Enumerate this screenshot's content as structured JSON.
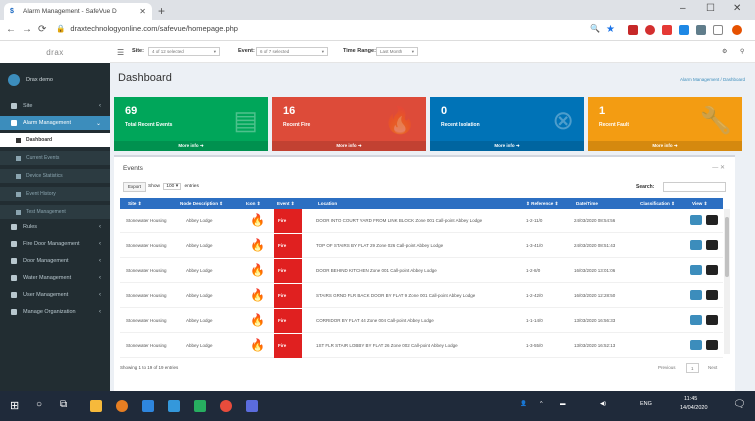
{
  "browser": {
    "tab_title": "Alarm Management - SafeVue D",
    "url": "draxtechnologyonline.com/safevue/homepage.php"
  },
  "logo": "drax",
  "user": {
    "name": "Drax demo"
  },
  "sidebar": {
    "items": [
      {
        "label": "Site"
      },
      {
        "label": "Alarm Management"
      },
      {
        "label": "Rules"
      },
      {
        "label": "Fire Door Management"
      },
      {
        "label": "Door Management"
      },
      {
        "label": "Water Management"
      },
      {
        "label": "User Management"
      },
      {
        "label": "Manage Organization"
      }
    ],
    "subitems": [
      {
        "label": "Dashboard"
      },
      {
        "label": "Current Events"
      },
      {
        "label": "Device Statistics"
      },
      {
        "label": "Event History"
      },
      {
        "label": "Test Management"
      }
    ]
  },
  "topbar": {
    "site_label": "Site:",
    "site_value": "4 of 12 selected",
    "event_label": "Event:",
    "event_value": "6 of 7 selected",
    "time_label": "Time Range:",
    "time_value": "Last Month"
  },
  "page": {
    "title": "Dashboard",
    "breadcrumb": "Alarm Management / Dashboard"
  },
  "boxes": [
    {
      "number": "69",
      "label": "Total Recent Events",
      "more": "More info",
      "color": "#00a65a"
    },
    {
      "number": "16",
      "label": "Recent Fire",
      "more": "More info",
      "color": "#dd4b39"
    },
    {
      "number": "0",
      "label": "Recent Isolation",
      "more": "More info",
      "color": "#0073b7"
    },
    {
      "number": "1",
      "label": "Recent Fault",
      "more": "More info",
      "color": "#f39c12"
    }
  ],
  "events": {
    "title": "Events",
    "export_label": "Export",
    "show_label": "Show",
    "show_value": "100",
    "entries_label": "entries",
    "search_label": "Search:",
    "columns": {
      "site": "Site",
      "node": "Node Description",
      "icon": "Icon",
      "event": "Event",
      "location": "Location",
      "reference": "Reference",
      "datetime": "Date/Time",
      "classification": "Classification",
      "view": "View"
    },
    "rows": [
      {
        "site": "Stonewater Housing",
        "node": "Abbey Lodge",
        "event": "Fire",
        "location": "DOOR INTO COURT YARD FROM LINK BLOCK Zone 001 Call-point Abbey Lodge",
        "reference": "1-2-11/0",
        "datetime": "24/03/2020 08:54:56"
      },
      {
        "site": "Stonewater Housing",
        "node": "Abbey Lodge",
        "event": "Fire",
        "location": "TOP OF STAIRS BY FLAT 29 Zone 026 Call-point Abbey Lodge",
        "reference": "1-3-41/0",
        "datetime": "24/03/2020 08:51:43"
      },
      {
        "site": "Stonewater Housing",
        "node": "Abbey Lodge",
        "event": "Fire",
        "location": "DOOR BEHIND KITCHEN Zone 001 Call-point Abbey Lodge",
        "reference": "1-2-8/0",
        "datetime": "16/03/2020 13:01:06"
      },
      {
        "site": "Stonewater Housing",
        "node": "Abbey Lodge",
        "event": "Fire",
        "location": "STAIRS GRND FLR BACK DOOR BY FLAT 9 Zone 001 Call-point Abbey Lodge",
        "reference": "1-2-42/0",
        "datetime": "16/03/2020 12:28:50"
      },
      {
        "site": "Stonewater Housing",
        "node": "Abbey Lodge",
        "event": "Fire",
        "location": "CORRIDOR BY FLAT 44 Zone 004 Call-point Abbey Lodge",
        "reference": "1-1-14/0",
        "datetime": "13/03/2020 16:56:33"
      },
      {
        "site": "Stonewater Housing",
        "node": "Abbey Lodge",
        "event": "Fire",
        "location": "1ST FLR STAIR LOBBY BY FLAT 26 Zone 002 Call-point Abbey Lodge",
        "reference": "1-3-55/0",
        "datetime": "13/03/2020 16:52:13"
      }
    ],
    "info": "Showing 1 to 19 of 19 entries",
    "prev": "Previous",
    "page": "1",
    "next": "Next"
  },
  "taskbar": {
    "lang": "ENG",
    "time": "11:45",
    "date": "14/04/2020"
  }
}
